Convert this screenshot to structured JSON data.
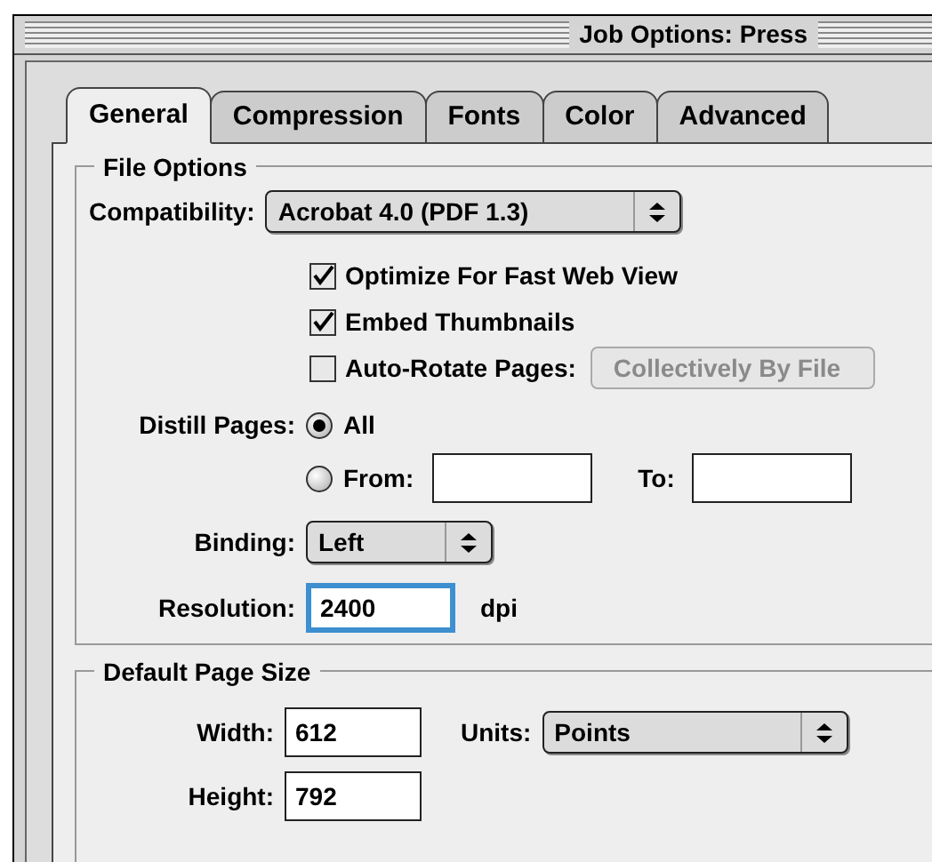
{
  "window": {
    "title": "Job Options: Press"
  },
  "tabs": [
    {
      "label": "General",
      "selected": true
    },
    {
      "label": "Compression",
      "selected": false
    },
    {
      "label": "Fonts",
      "selected": false
    },
    {
      "label": "Color",
      "selected": false
    },
    {
      "label": "Advanced",
      "selected": false
    }
  ],
  "file_options": {
    "title": "File Options",
    "compatibility": {
      "label": "Compatibility:",
      "value": "Acrobat 4.0 (PDF 1.3)"
    },
    "checkboxes": [
      {
        "label": "Optimize For Fast Web View",
        "checked": true
      },
      {
        "label": "Embed Thumbnails",
        "checked": true
      },
      {
        "label": "Auto-Rotate Pages:",
        "checked": false,
        "popup": {
          "value": "Collectively By File",
          "disabled": true
        }
      }
    ],
    "distill_pages": {
      "label": "Distill Pages:",
      "options": [
        {
          "label": "All",
          "selected": true
        },
        {
          "label": "From:",
          "selected": false
        }
      ],
      "to": {
        "label": "To:"
      }
    },
    "binding": {
      "label": "Binding:",
      "value": "Left"
    },
    "resolution": {
      "label": "Resolution:",
      "value": "2400",
      "unit": "dpi",
      "focused": true
    }
  },
  "page_size": {
    "title": "Default Page Size",
    "width": {
      "label": "Width:",
      "value": "612"
    },
    "units": {
      "label": "Units:",
      "value": "Points"
    },
    "height": {
      "label": "Height:",
      "value": "792"
    }
  }
}
